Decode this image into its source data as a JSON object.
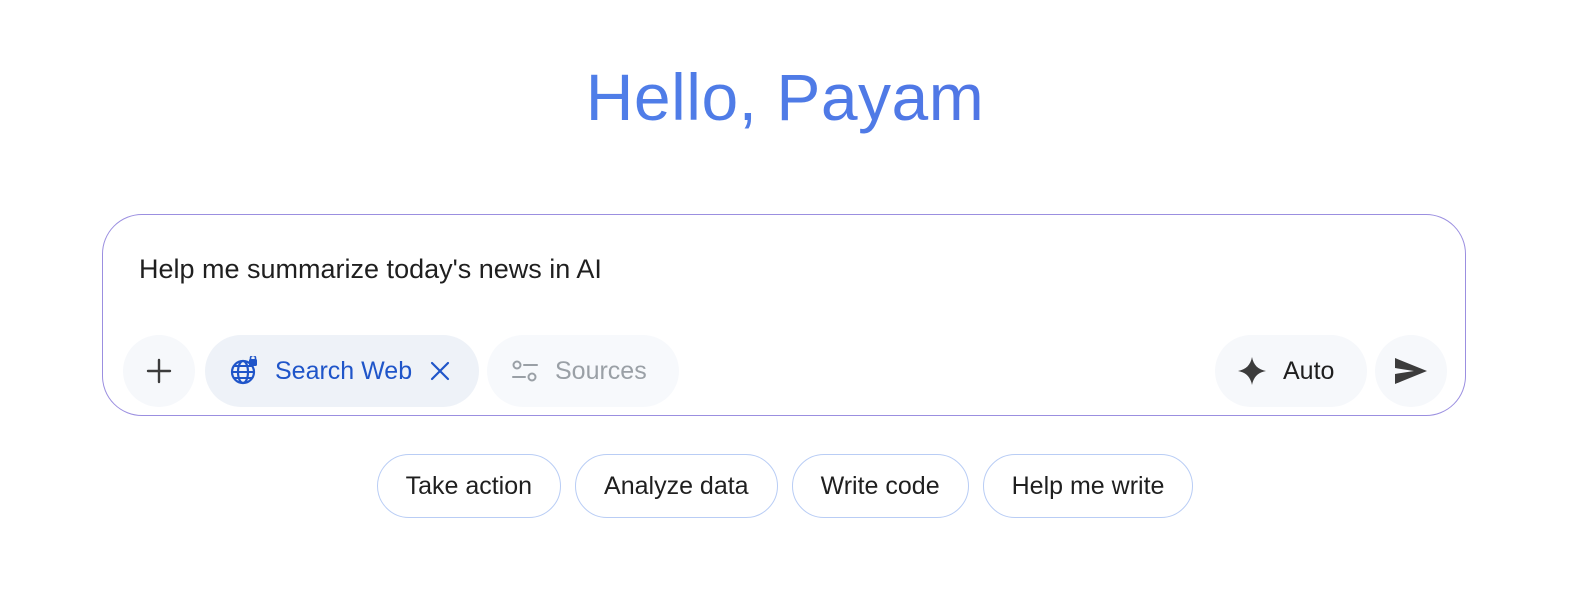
{
  "greeting": "Hello, Payam",
  "prompt": {
    "value": "Help me summarize today's news in AI"
  },
  "toolbar": {
    "add_icon": "plus-icon",
    "search_chip": {
      "label": "Search Web",
      "icon": "globe-lock-icon",
      "close_icon": "close-icon"
    },
    "sources_chip": {
      "label": "Sources",
      "icon": "sliders-icon"
    },
    "model_button": {
      "label": "Auto",
      "icon": "sparkle-icon"
    },
    "send_icon": "send-icon"
  },
  "suggestions": [
    {
      "label": "Take action"
    },
    {
      "label": "Analyze data"
    },
    {
      "label": "Write code"
    },
    {
      "label": "Help me write"
    }
  ],
  "colors": {
    "accent_blue": "#1f55c9",
    "greeting_gradient_start": "#4f86ec",
    "greeting_gradient_end": "#5562df",
    "composer_border": "#9b8fe0",
    "suggestion_border": "#b9cdf5"
  }
}
